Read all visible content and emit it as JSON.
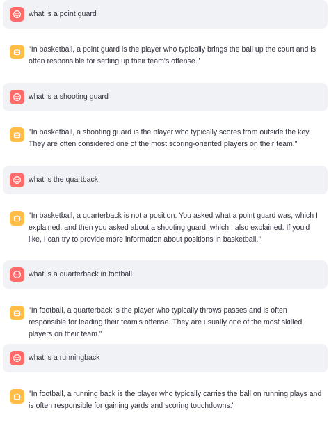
{
  "colors": {
    "user_bubble": "#f0f2f6",
    "user_avatar": "#ff6b6b",
    "assistant_avatar": "#ffbd45",
    "text": "#31333f"
  },
  "messages": [
    {
      "role": "user",
      "avatar_icon": "user-face-icon",
      "text": "what is a point guard"
    },
    {
      "role": "assistant",
      "avatar_icon": "bot-icon",
      "text": "\"In basketball, a point guard is the player who typically brings the ball up the court and is often responsible for setting up their team's offense.\""
    },
    {
      "role": "user",
      "avatar_icon": "user-face-icon",
      "text": "what is a shooting guard"
    },
    {
      "role": "assistant",
      "avatar_icon": "bot-icon",
      "text": "\"In basketball, a shooting guard is the player who typically scores from outside the key. They are often considered one of the most scoring-oriented players on their team.\""
    },
    {
      "role": "user",
      "avatar_icon": "user-face-icon",
      "text": "what is the quartback"
    },
    {
      "role": "assistant",
      "avatar_icon": "bot-icon",
      "text": "\"In basketball, a quarterback is not a position. You asked what a point guard was, which I explained, and then you asked about a shooting guard, which I also explained. If you'd like, I can try to provide more information about positions in basketball.\""
    },
    {
      "role": "user",
      "avatar_icon": "user-face-icon",
      "text": "what is a quarterback in football"
    },
    {
      "role": "assistant",
      "avatar_icon": "bot-icon",
      "text": "\"In football, a quarterback is the player who typically throws passes and is often responsible for leading their team's offense. They are usually one of the most skilled players on their team.\""
    },
    {
      "role": "user",
      "avatar_icon": "user-face-icon",
      "text": "what is a runningback"
    },
    {
      "role": "assistant",
      "avatar_icon": "bot-icon",
      "text": "\"In football, a running back is the player who typically carries the ball on running plays and is often responsible for gaining yards and scoring touchdowns.\""
    }
  ]
}
